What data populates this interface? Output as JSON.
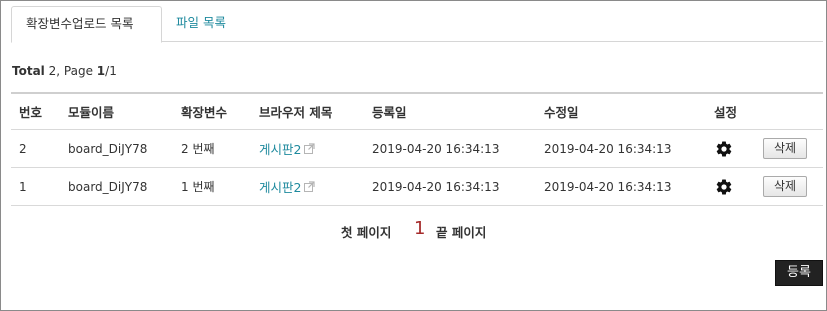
{
  "tabs": [
    {
      "label": "확장변수업로드 목록",
      "active": true
    },
    {
      "label": "파일 목록",
      "active": false
    }
  ],
  "summary": {
    "total_label": "Total",
    "total_value": "2",
    "page_label": "Page",
    "page_current": "1",
    "page_sep": "/1"
  },
  "table": {
    "headers": [
      "번호",
      "모듈이름",
      "확장변수",
      "브라우저 제목",
      "등록일",
      "수정일",
      "설정"
    ],
    "rows": [
      {
        "no": "2",
        "module": "board_DiJY78",
        "ext_var": "2 번째",
        "browser_title": "게시판2",
        "registered": "2019-04-20 16:34:13",
        "modified": "2019-04-20 16:34:13",
        "delete_label": "삭제"
      },
      {
        "no": "1",
        "module": "board_DiJY78",
        "ext_var": "1 번째",
        "browser_title": "게시판2",
        "registered": "2019-04-20 16:34:13",
        "modified": "2019-04-20 16:34:13",
        "delete_label": "삭제"
      }
    ]
  },
  "pager": {
    "first": "첫 페이지",
    "current": "1",
    "last": "끝 페이지"
  },
  "register_label": "등록",
  "colors": {
    "link": "#1f8a9e",
    "current_page": "#a52a2a",
    "register_bg": "#222222"
  },
  "icons": {
    "settings": "gear-icon",
    "external": "external-link-icon"
  }
}
